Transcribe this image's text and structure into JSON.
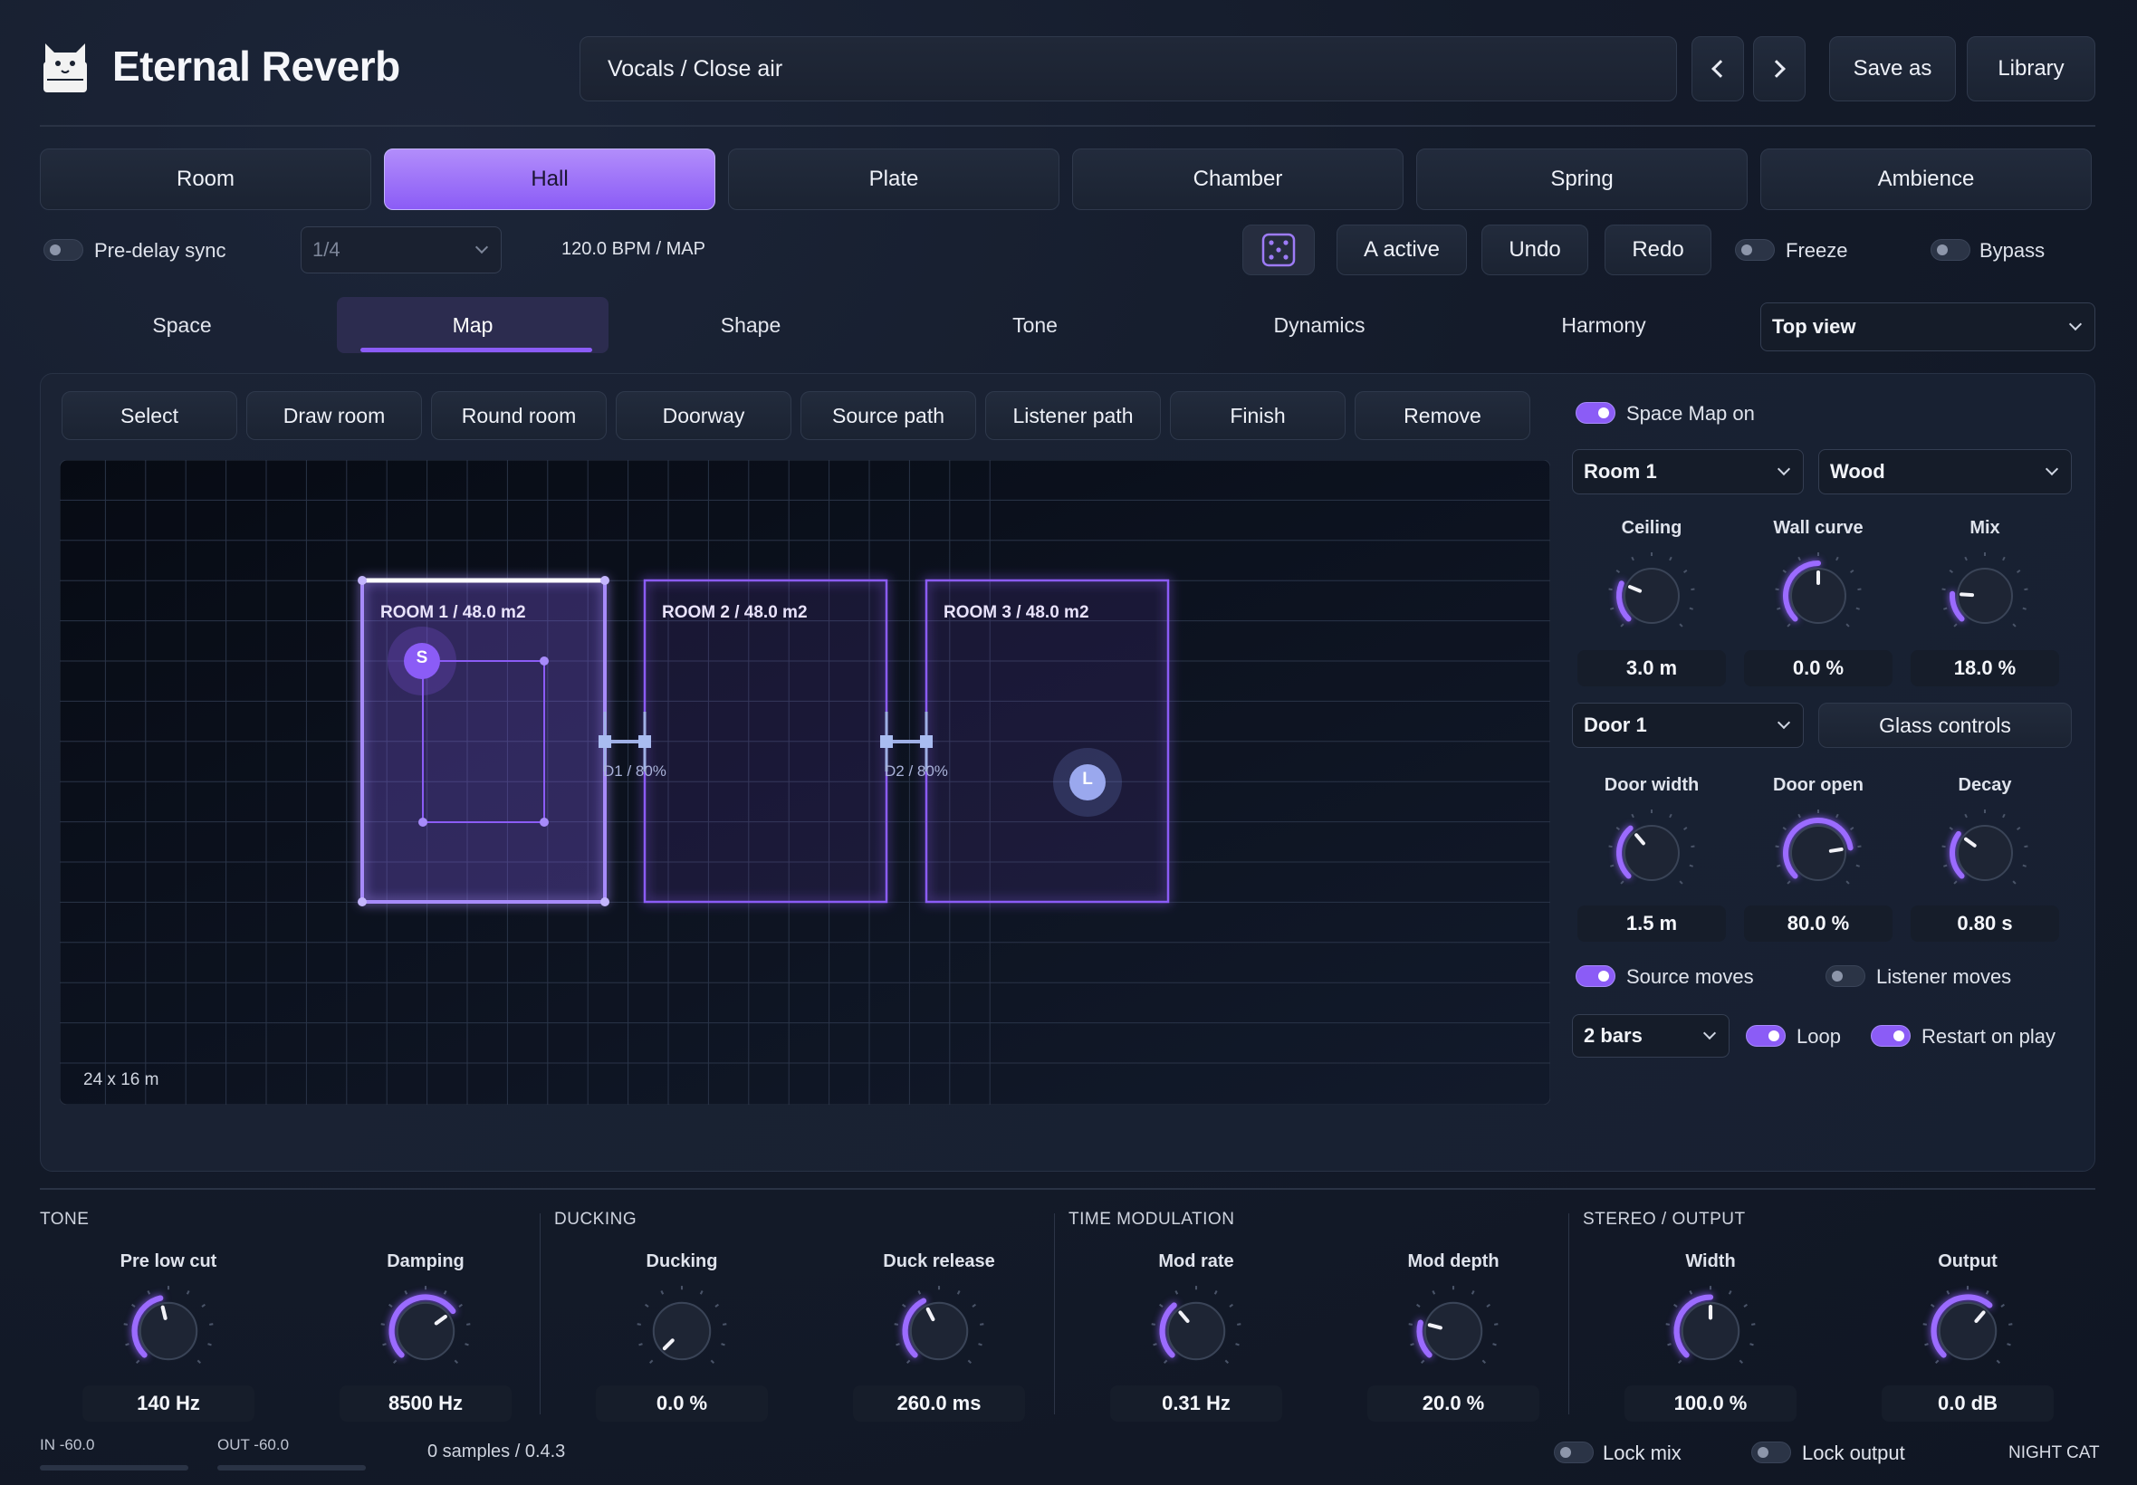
{
  "app": {
    "title": "Eternal Reverb",
    "logo_icon": "cat-icon"
  },
  "preset": {
    "name": "Vocals / Close air",
    "save_as": "Save as",
    "library": "Library"
  },
  "modes": [
    {
      "label": "Room",
      "active": false
    },
    {
      "label": "Hall",
      "active": true
    },
    {
      "label": "Plate",
      "active": false
    },
    {
      "label": "Chamber",
      "active": false
    },
    {
      "label": "Spring",
      "active": false
    },
    {
      "label": "Ambience",
      "active": false
    }
  ],
  "toolbar": {
    "predelay_sync": "Pre-delay sync",
    "division": "1/4",
    "bpm": "120.0 BPM / MAP",
    "random_icon": "dice-icon",
    "ab": "A active",
    "undo": "Undo",
    "redo": "Redo",
    "freeze": "Freeze",
    "bypass": "Bypass"
  },
  "tabs": [
    "Space",
    "Map",
    "Shape",
    "Tone",
    "Dynamics",
    "Harmony"
  ],
  "active_tab": "Map",
  "view_select": "Top view",
  "map_tools": [
    "Select",
    "Draw room",
    "Round room",
    "Doorway",
    "Source path",
    "Listener path",
    "Finish",
    "Remove"
  ],
  "map": {
    "size_label": "24 x 16 m",
    "rooms": [
      "ROOM 1 / 48.0 m2",
      "ROOM 2 / 48.0 m2",
      "ROOM 3 / 48.0 m2"
    ],
    "doors": [
      "D1 / 80%",
      "D2 / 80%"
    ],
    "source_marker": "S",
    "listener_marker": "L"
  },
  "side": {
    "space_map_on": "Space Map on",
    "room_select": "Room 1",
    "material_select": "Wood",
    "knobs_row1": [
      {
        "title": "Ceiling",
        "value": "3.0 m",
        "level": 0.25
      },
      {
        "title": "Wall curve",
        "value": "0.0 %",
        "level": 0.5
      },
      {
        "title": "Mix",
        "value": "18.0 %",
        "level": 0.18
      }
    ],
    "door_select": "Door 1",
    "glass_controls": "Glass controls",
    "knobs_row2": [
      {
        "title": "Door width",
        "value": "1.5 m",
        "level": 0.35
      },
      {
        "title": "Door open",
        "value": "80.0 %",
        "level": 0.8
      },
      {
        "title": "Decay",
        "value": "0.80 s",
        "level": 0.3
      }
    ],
    "source_moves": "Source moves",
    "listener_moves": "Listener moves",
    "bars_select": "2 bars",
    "loop": "Loop",
    "restart_on_play": "Restart on play"
  },
  "bottom": {
    "sections": [
      "TONE",
      "DUCKING",
      "TIME MODULATION",
      "STEREO / OUTPUT"
    ],
    "knobs": [
      {
        "title": "Pre low cut",
        "value": "140 Hz",
        "level": 0.45
      },
      {
        "title": "Damping",
        "value": "8500 Hz",
        "level": 0.7
      },
      {
        "title": "Ducking",
        "value": "0.0 %",
        "level": 0.0
      },
      {
        "title": "Duck release",
        "value": "260.0 ms",
        "level": 0.4
      },
      {
        "title": "Mod rate",
        "value": "0.31 Hz",
        "level": 0.35
      },
      {
        "title": "Mod depth",
        "value": "20.0 %",
        "level": 0.22
      },
      {
        "title": "Width",
        "value": "100.0 %",
        "level": 0.5
      },
      {
        "title": "Output",
        "value": "0.0 dB",
        "level": 0.65
      }
    ],
    "in_meter": "IN -60.0",
    "out_meter": "OUT -60.0",
    "status": "0 samples / 0.4.3",
    "lock_mix": "Lock mix",
    "lock_output": "Lock output",
    "brand": "NIGHT CAT"
  },
  "colors": {
    "accent": "#8b5cf6",
    "accent_light": "#a78bfa",
    "bg": "#141b2a"
  }
}
